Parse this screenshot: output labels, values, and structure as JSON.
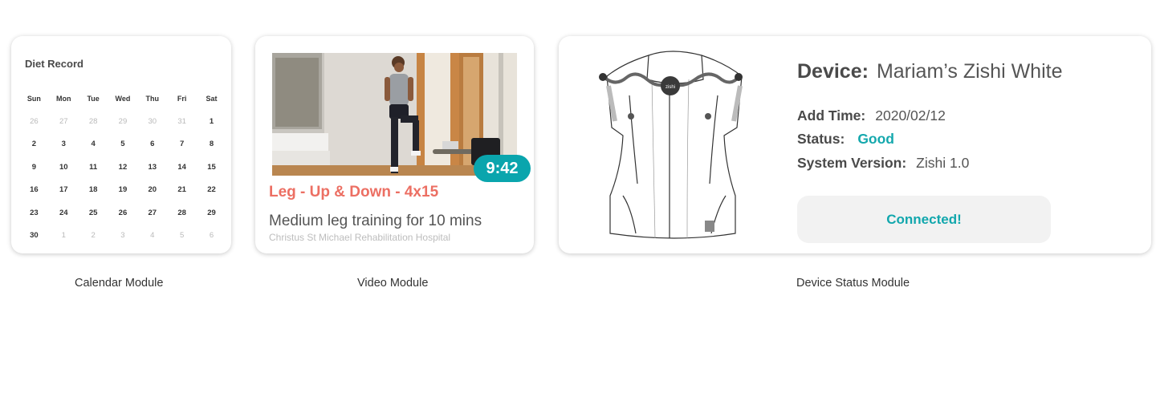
{
  "calendar": {
    "title": "Diet Record",
    "weekdays": [
      "Sun",
      "Mon",
      "Tue",
      "Wed",
      "Thu",
      "Fri",
      "Sat"
    ],
    "weeks": [
      [
        "26",
        "27",
        "28",
        "29",
        "30",
        "31",
        "1"
      ],
      [
        "2",
        "3",
        "4",
        "5",
        "6",
        "7",
        "8"
      ],
      [
        "9",
        "10",
        "11",
        "12",
        "13",
        "14",
        "15"
      ],
      [
        "16",
        "17",
        "18",
        "19",
        "20",
        "21",
        "22"
      ],
      [
        "23",
        "24",
        "25",
        "26",
        "27",
        "28",
        "29"
      ],
      [
        "30",
        "1",
        "2",
        "3",
        "4",
        "5",
        "6"
      ]
    ],
    "caption": "Calendar Module"
  },
  "video": {
    "duration": "9:42",
    "title": "Leg - Up & Down - 4x15",
    "description": "Medium leg training for 10 mins",
    "location": "Christus St Michael Rehabilitation Hospital",
    "caption": "Video Module"
  },
  "device": {
    "name_label": "Device:",
    "name_value": "Mariam’s Zishi White",
    "add_time_label": "Add Time:",
    "add_time_value": "2020/02/12",
    "status_label": "Status:",
    "status_value": "Good",
    "version_label": "System Version:",
    "version_value": "Zishi 1.0",
    "connected_label": "Connected!",
    "logo_text": "zishi",
    "caption": "Device Status Module"
  },
  "colors": {
    "accent_teal": "#0aa5ad",
    "title_coral": "#ec6f63"
  }
}
